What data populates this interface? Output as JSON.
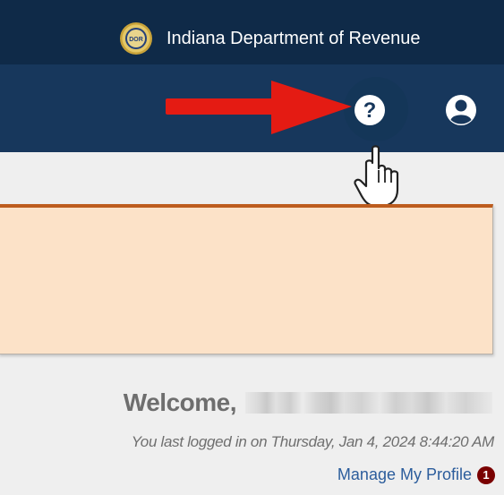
{
  "header": {
    "agency_name": "Indiana Department of Revenue",
    "seal_text": "DOR"
  },
  "nav": {
    "help_icon": "question-circle-icon",
    "account_icon": "user-circle-icon",
    "help_glyph": "?"
  },
  "welcome": {
    "greeting": "Welcome,",
    "last_login": "You last logged in on Thursday, Jan 4, 2024 8:44:20 AM"
  },
  "profile": {
    "link_label": "Manage My Profile",
    "notification_count": "1"
  },
  "annotations": {
    "arrow_icon": "red-arrow-pointer",
    "cursor_icon": "hand-pointer-icon"
  },
  "colors": {
    "topbar": "#0f2a48",
    "navbar": "#17375c",
    "alert_border": "#bd5c1e",
    "alert_fill": "#fce2c8",
    "link": "#2c5d9c",
    "badge": "#7a0000",
    "arrow": "#e41b13"
  }
}
